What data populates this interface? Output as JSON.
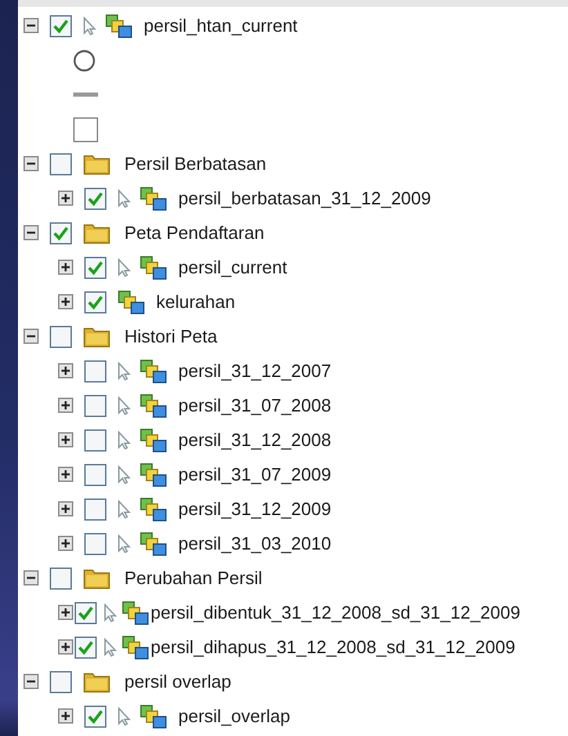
{
  "tree": [
    {
      "kind": "layer",
      "label": "persil_htan_current",
      "checked": true,
      "selectable": true,
      "expanded": true,
      "children": [
        {
          "kind": "circle"
        },
        {
          "kind": "line"
        },
        {
          "kind": "square"
        }
      ]
    },
    {
      "kind": "group",
      "label": "Persil Berbatasan",
      "checked": false,
      "expanded": true,
      "children": [
        {
          "kind": "layer",
          "label": "persil_berbatasan_31_12_2009",
          "checked": true,
          "selectable": true,
          "expanded": false
        }
      ]
    },
    {
      "kind": "group",
      "label": "Peta Pendaftaran",
      "checked": true,
      "expanded": true,
      "children": [
        {
          "kind": "layer",
          "label": "persil_current",
          "checked": true,
          "selectable": true,
          "expanded": false
        },
        {
          "kind": "layer",
          "label": "kelurahan",
          "checked": true,
          "selectable": false,
          "expanded": false
        }
      ]
    },
    {
      "kind": "group",
      "label": "Histori Peta",
      "checked": false,
      "expanded": true,
      "children": [
        {
          "kind": "layer",
          "label": "persil_31_12_2007",
          "checked": false,
          "selectable": true,
          "expanded": false
        },
        {
          "kind": "layer",
          "label": "persil_31_07_2008",
          "checked": false,
          "selectable": true,
          "expanded": false
        },
        {
          "kind": "layer",
          "label": "persil_31_12_2008",
          "checked": false,
          "selectable": true,
          "expanded": false
        },
        {
          "kind": "layer",
          "label": "persil_31_07_2009",
          "checked": false,
          "selectable": true,
          "expanded": false
        },
        {
          "kind": "layer",
          "label": "persil_31_12_2009",
          "checked": false,
          "selectable": true,
          "expanded": false
        },
        {
          "kind": "layer",
          "label": "persil_31_03_2010",
          "checked": false,
          "selectable": true,
          "expanded": false
        }
      ]
    },
    {
      "kind": "group",
      "label": "Perubahan Persil",
      "checked": false,
      "expanded": true,
      "children": [
        {
          "kind": "layer",
          "label": "persil_dibentuk_31_12_2008_sd_31_12_2009",
          "checked": true,
          "selectable": true,
          "expanded": false
        },
        {
          "kind": "layer",
          "label": "persil_dihapus_31_12_2008_sd_31_12_2009",
          "checked": true,
          "selectable": true,
          "expanded": false
        }
      ]
    },
    {
      "kind": "group",
      "label": "persil overlap",
      "checked": false,
      "expanded": true,
      "children": [
        {
          "kind": "layer",
          "label": "persil_overlap",
          "checked": true,
          "selectable": true,
          "expanded": false
        }
      ]
    }
  ]
}
